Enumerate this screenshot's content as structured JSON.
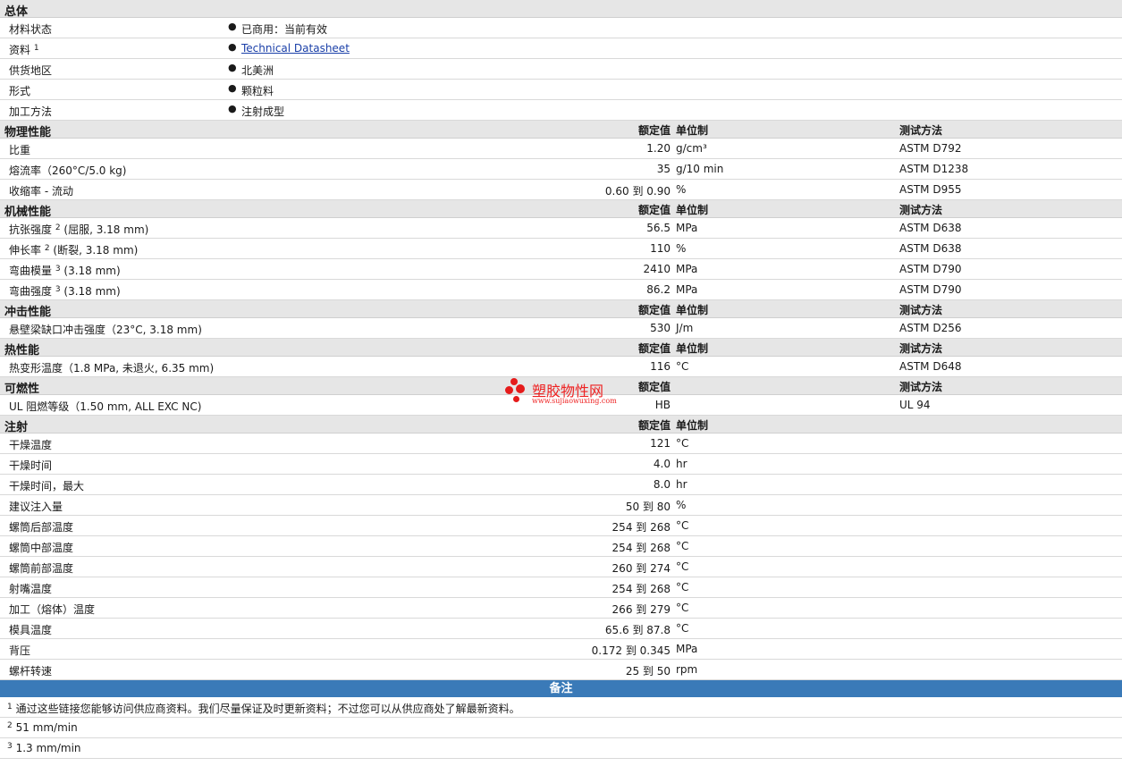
{
  "general": {
    "title": "总体",
    "rows": [
      {
        "label": "材料状态",
        "value": "已商用：当前有效"
      },
      {
        "label": "资料",
        "sup": "1",
        "value": "Technical Datasheet"
      },
      {
        "label": "供货地区",
        "value": "北美洲"
      },
      {
        "label": "形式",
        "value": "颗粒料"
      },
      {
        "label": "加工方法",
        "value": "注射成型"
      }
    ]
  },
  "sections": [
    {
      "title": "物理性能",
      "h_value": "额定值",
      "h_unit": "单位制",
      "h_method": "测试方法",
      "rows": [
        {
          "label": "比重",
          "value": "1.20",
          "unit": "g/cm³",
          "method": "ASTM D792"
        },
        {
          "label": "熔流率（260°C/5.0 kg)",
          "value": "35",
          "unit": "g/10 min",
          "method": "ASTM D1238"
        },
        {
          "label": "收缩率 - 流动",
          "value": "0.60 到  0.90",
          "unit": "%",
          "method": "ASTM D955"
        }
      ]
    },
    {
      "title": "机械性能",
      "h_value": "额定值",
      "h_unit": "单位制",
      "h_method": "测试方法",
      "rows": [
        {
          "label": "抗张强度",
          "sup": "2",
          "label2": "(屈服, 3.18 mm)",
          "value": "56.5",
          "unit": "MPa",
          "method": "ASTM D638"
        },
        {
          "label": "伸长率",
          "sup": "2",
          "label2": "(断裂, 3.18 mm)",
          "value": "110",
          "unit": "%",
          "method": "ASTM D638"
        },
        {
          "label": "弯曲模量",
          "sup": "3",
          "label2": "(3.18 mm)",
          "value": "2410",
          "unit": "MPa",
          "method": "ASTM D790"
        },
        {
          "label": "弯曲强度",
          "sup": "3",
          "label2": "(3.18 mm)",
          "value": "86.2",
          "unit": "MPa",
          "method": "ASTM D790"
        }
      ]
    },
    {
      "title": "冲击性能",
      "h_value": "额定值",
      "h_unit": "单位制",
      "h_method": "测试方法",
      "rows": [
        {
          "label": "悬壁梁缺口冲击强度（23°C, 3.18 mm)",
          "value": "530",
          "unit": "J/m",
          "method": "ASTM D256"
        }
      ]
    },
    {
      "title": "热性能",
      "h_value": "额定值",
      "h_unit": "单位制",
      "h_method": "测试方法",
      "rows": [
        {
          "label": "热变形温度（1.8 MPa, 未退火, 6.35 mm)",
          "value": "116",
          "unit": "°C",
          "method": "ASTM D648"
        }
      ]
    },
    {
      "title": "可燃性",
      "h_value": "额定值",
      "h_unit": "",
      "h_method": "测试方法",
      "rows": [
        {
          "label": "UL 阻燃等级（1.50 mm, ALL EXC NC)",
          "value": "HB",
          "unit": "",
          "method": "UL 94"
        }
      ]
    },
    {
      "title": "注射",
      "h_value": "额定值",
      "h_unit": "单位制",
      "h_method": "",
      "rows": [
        {
          "label": "干燥温度",
          "value": "121",
          "unit": "°C",
          "method": ""
        },
        {
          "label": "干燥时间",
          "value": "4.0",
          "unit": "hr",
          "method": ""
        },
        {
          "label": "干燥时间，最大",
          "value": "8.0",
          "unit": "hr",
          "method": ""
        },
        {
          "label": "建议注入量",
          "value": "50 到  80",
          "unit": "%",
          "method": ""
        },
        {
          "label": "螺筒后部温度",
          "value": "254 到  268",
          "unit": "°C",
          "method": ""
        },
        {
          "label": "螺筒中部温度",
          "value": "254 到  268",
          "unit": "°C",
          "method": ""
        },
        {
          "label": "螺筒前部温度",
          "value": "260 到  274",
          "unit": "°C",
          "method": ""
        },
        {
          "label": "射嘴温度",
          "value": "254 到  268",
          "unit": "°C",
          "method": ""
        },
        {
          "label": "加工（熔体）温度",
          "value": "266 到  279",
          "unit": "°C",
          "method": ""
        },
        {
          "label": "模具温度",
          "value": "65.6 到  87.8",
          "unit": "°C",
          "method": ""
        },
        {
          "label": "背压",
          "value": "0.172 到  0.345",
          "unit": "MPa",
          "method": ""
        },
        {
          "label": "螺杆转速",
          "value": "25 到  50",
          "unit": "rpm",
          "method": ""
        }
      ]
    }
  ],
  "notes": {
    "title": "备注",
    "items": [
      {
        "sup": "1",
        "text": "通过这些链接您能够访问供应商资料。我们尽量保证及时更新资料；不过您可以从供应商处了解最新资料。"
      },
      {
        "sup": "2",
        "text": "51 mm/min"
      },
      {
        "sup": "3",
        "text": "1.3 mm/min"
      }
    ]
  },
  "watermark": {
    "text": "塑胶物性网",
    "sub": "www.sujiaowuxing.com",
    "color": "#e51b1b"
  }
}
